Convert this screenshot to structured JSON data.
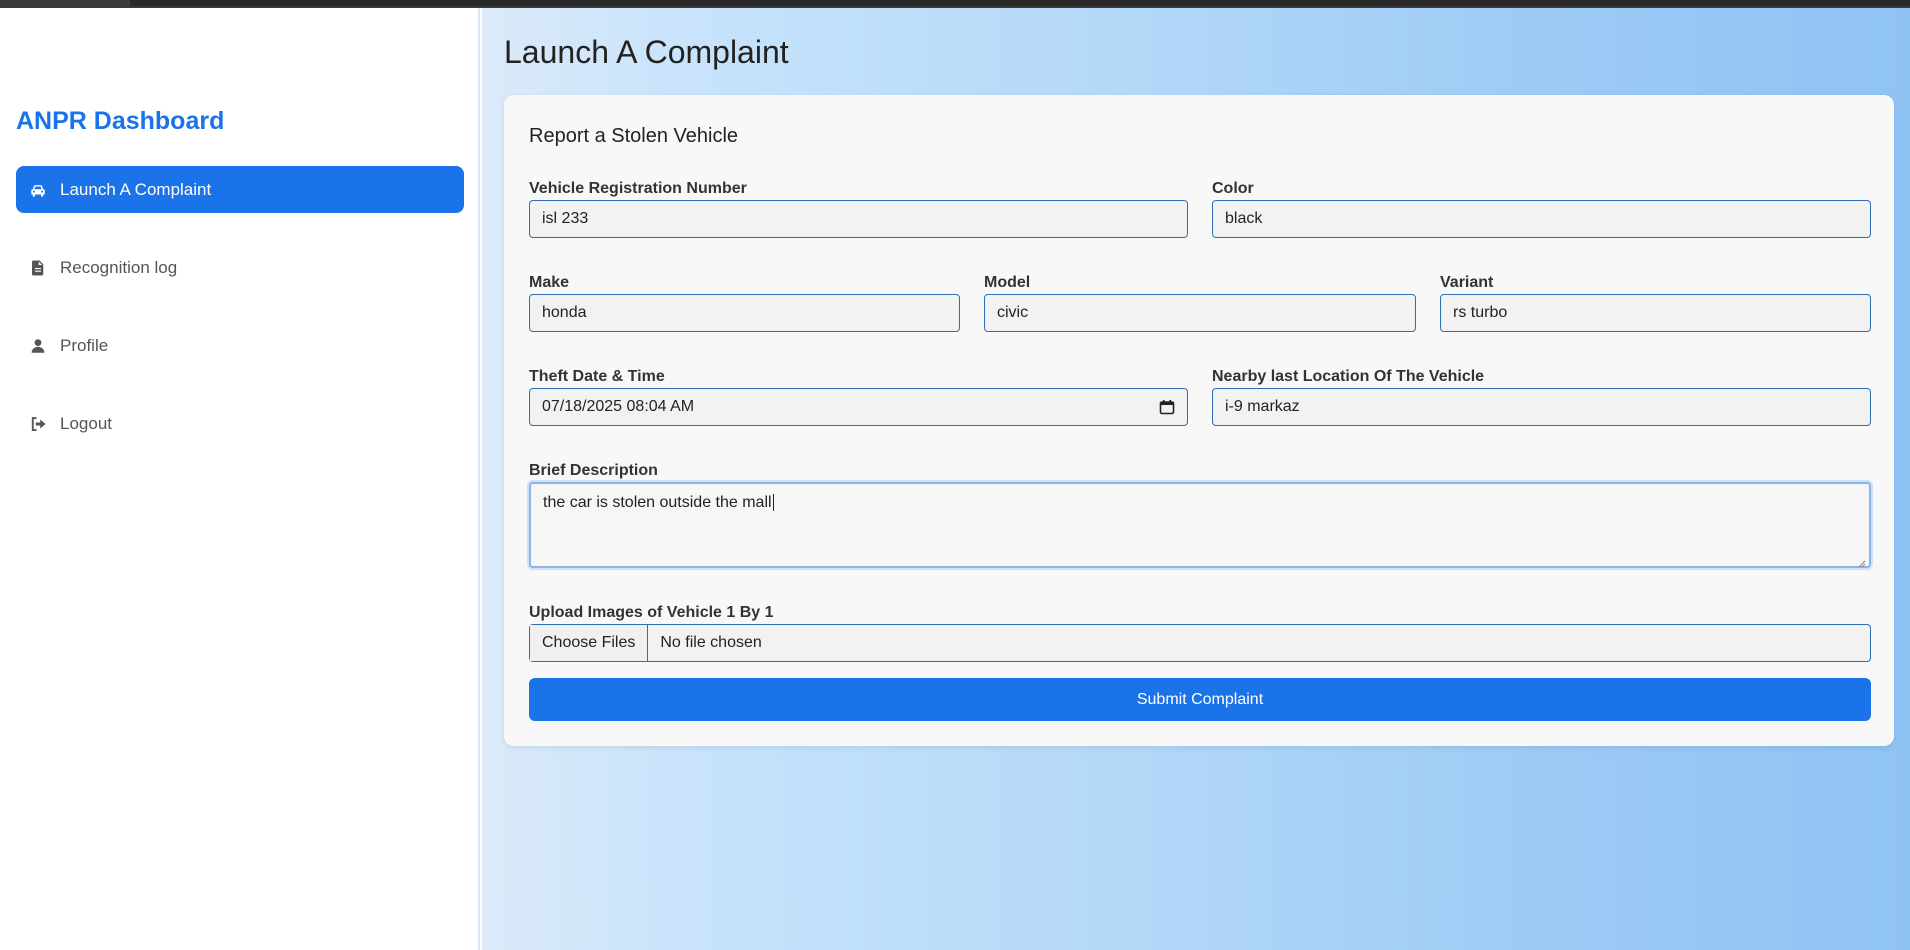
{
  "sidebar": {
    "brand": "ANPR Dashboard",
    "items": [
      {
        "label": "Launch A Complaint",
        "icon": "car-icon",
        "active": true
      },
      {
        "label": "Recognition log",
        "icon": "file-icon",
        "active": false
      },
      {
        "label": "Profile",
        "icon": "user-icon",
        "active": false
      },
      {
        "label": "Logout",
        "icon": "logout-icon",
        "active": false
      }
    ]
  },
  "main": {
    "title": "Launch A Complaint",
    "form": {
      "title": "Report a Stolen Vehicle",
      "registration": {
        "label": "Vehicle Registration Number",
        "value": "isl 233"
      },
      "color": {
        "label": "Color",
        "value": "black"
      },
      "make": {
        "label": "Make",
        "value": "honda"
      },
      "model": {
        "label": "Model",
        "value": "civic"
      },
      "variant": {
        "label": "Variant",
        "value": "rs turbo"
      },
      "theft_datetime": {
        "label": "Theft Date & Time",
        "value": "07/18/2025 08:04  AM"
      },
      "location": {
        "label": "Nearby last Location Of The Vehicle",
        "value": "i-9 markaz"
      },
      "description": {
        "label": "Brief Description",
        "value": "the car is stolen outside the mall"
      },
      "upload": {
        "label": "Upload Images of Vehicle 1 By 1",
        "button": "Choose Files",
        "status": "No file chosen"
      },
      "submit": "Submit Complaint"
    }
  },
  "colors": {
    "accent": "#1a73e8",
    "border": "#2f6eb5"
  }
}
